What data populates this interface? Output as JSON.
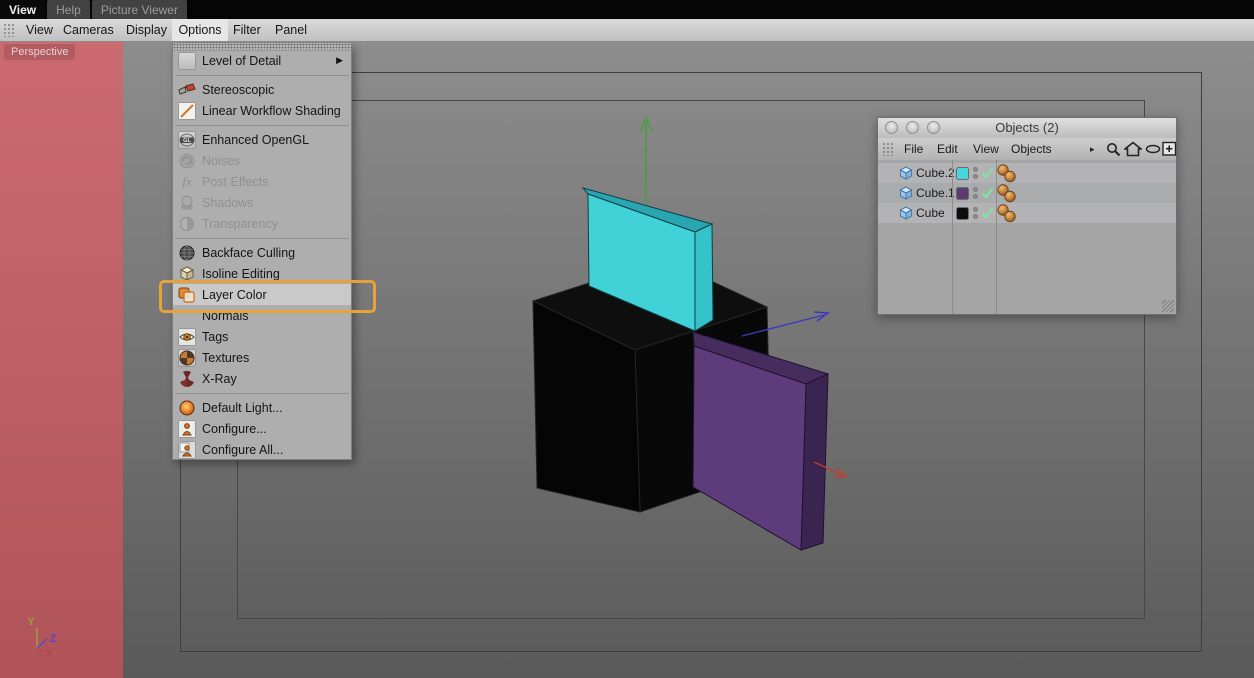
{
  "tab_bar": {
    "tabs": [
      {
        "label": "View",
        "active": true
      },
      {
        "label": "Help",
        "active": false
      },
      {
        "label": "Picture Viewer",
        "active": false
      }
    ]
  },
  "menu_bar": {
    "active_item": "Options",
    "items": [
      {
        "label": "View"
      },
      {
        "label": "Cameras"
      },
      {
        "label": "Display"
      },
      {
        "label": "Options"
      },
      {
        "label": "Filter"
      },
      {
        "label": "Panel"
      }
    ]
  },
  "viewport": {
    "camera_label": "Perspective"
  },
  "options_menu": {
    "items": [
      {
        "label": "Level of Detail",
        "state": "normal",
        "has_submenu": true
      },
      {
        "label": "Stereoscopic",
        "state": "normal"
      },
      {
        "label": "Linear Workflow Shading",
        "state": "normal"
      },
      {
        "label": "Enhanced OpenGL",
        "state": "normal"
      },
      {
        "label": "Noises",
        "state": "disabled"
      },
      {
        "label": "Post Effects",
        "state": "disabled"
      },
      {
        "label": "Shadows",
        "state": "disabled"
      },
      {
        "label": "Transparency",
        "state": "disabled"
      },
      {
        "label": "Backface Culling",
        "state": "normal"
      },
      {
        "label": "Isoline Editing",
        "state": "normal"
      },
      {
        "label": "Layer Color",
        "state": "highlighted"
      },
      {
        "label": "Normals",
        "state": "normal"
      },
      {
        "label": "Tags",
        "state": "normal"
      },
      {
        "label": "Textures",
        "state": "normal"
      },
      {
        "label": "X-Ray",
        "state": "normal"
      },
      {
        "label": "Default Light...",
        "state": "normal"
      },
      {
        "label": "Configure...",
        "state": "normal"
      },
      {
        "label": "Configure All...",
        "state": "normal"
      }
    ],
    "submenu_arrow": "▶",
    "gl_badge": "GL",
    "fx_glyph": "fx"
  },
  "annotation": {
    "highlight_color": "#e8a23c"
  },
  "objects_panel": {
    "title": "Objects (2)",
    "menu": {
      "items": [
        {
          "label": "File"
        },
        {
          "label": "Edit"
        },
        {
          "label": "View"
        },
        {
          "label": "Objects"
        }
      ],
      "overflow_arrow": "▸"
    },
    "rows": [
      {
        "name": "Cube.2",
        "color": "#45d8dc"
      },
      {
        "name": "Cube.1",
        "color": "#5c3a74"
      },
      {
        "name": "Cube",
        "color": "#0b0b0b"
      }
    ]
  },
  "scene": {
    "axis_labels": {
      "x": "X",
      "y": "Y",
      "z": "Z"
    },
    "axis_colors": {
      "x": "#c23c2c",
      "y": "#4a9e3f",
      "z": "#3c38bc"
    },
    "gizmo_colors": {
      "x": "#b04343",
      "y": "#9aa03c",
      "z": "#5a48c8"
    },
    "cubes": {
      "cyan": {
        "front": "#41d2d8",
        "top": "#2aa6b2",
        "side": "#35c2ca"
      },
      "black": {
        "front": "#050505",
        "top": "#0e0e0e",
        "side": "#080808"
      },
      "purple": {
        "front": "#5e3c7c",
        "top": "#462d5e",
        "side": "#3a2550"
      }
    }
  }
}
